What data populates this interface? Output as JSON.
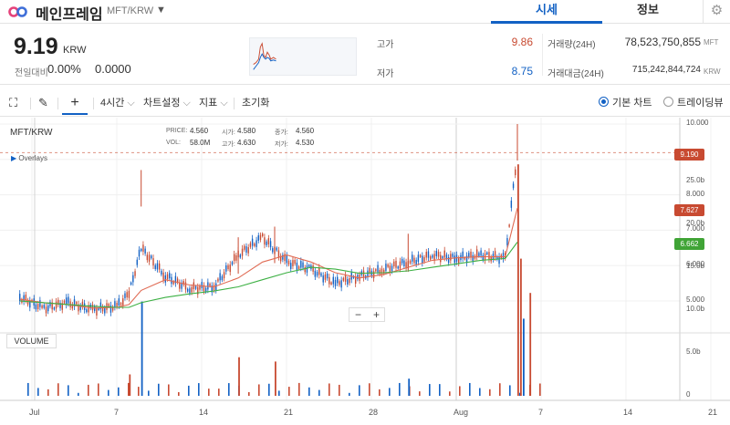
{
  "header": {
    "coin_name": "메인프레임",
    "pair": "MFT/KRW",
    "tabs": [
      {
        "label": "시세",
        "active": true
      },
      {
        "label": "정보",
        "active": false
      }
    ]
  },
  "summary": {
    "price": "9.19",
    "unit": "KRW",
    "change_label": "전일대비",
    "change_rate": "0.00%",
    "change_amount": "0.0000",
    "high_label": "고가",
    "high": "9.86",
    "low_label": "저가",
    "low": "8.75",
    "volume_label": "거래량(24H)",
    "volume": "78,523,750,855",
    "volume_unit": "MFT",
    "value_label": "거래대금(24H)",
    "value": "715,242,844,724",
    "value_unit": "KRW"
  },
  "toolbar": {
    "interval": "4시간",
    "chart_settings": "차트설정",
    "indicators": "지표",
    "reset": "초기화",
    "view_basic": "기본 차트",
    "view_trading": "트레이딩뷰"
  },
  "chart_labels": {
    "pair": "MFT/KRW",
    "overlays": "Overlays",
    "legend": {
      "price_key": "PRICE:",
      "price": "4.560",
      "open_key": "시가:",
      "open": "4.580",
      "close_key": "종가:",
      "close": "4.560",
      "vol_key": "VOL:",
      "vol": "58.0M",
      "high_key": "고가:",
      "high": "4.630",
      "low_key": "저가:",
      "low": "4.530"
    },
    "volume": "VOLUME",
    "zoom_out": "−",
    "zoom_in": "+",
    "tag_current": "9.190",
    "tag_ma_fast": "7.627",
    "tag_ma_slow": "6.662"
  },
  "colors": {
    "up": "#c84a31",
    "down": "#1261c4",
    "accent": "#1261c4",
    "ma_fast": "#e06b54",
    "ma_slow": "#3cb043",
    "ma_slow_tag": "#40a436"
  },
  "chart_data": [
    {
      "type": "line",
      "title": "",
      "x_ticks": [
        "Jul",
        "7",
        "14",
        "21",
        "28",
        "Aug",
        "7",
        "14",
        "21"
      ],
      "y_ticks": [
        "5.000",
        "6.000",
        "7.000",
        "8.000",
        "9.000",
        "10.000"
      ],
      "ylim": [
        4.0,
        10.1
      ],
      "current_price": 9.19,
      "series": [
        {
          "x": [
            "Jun 30",
            "Jul 2",
            "Jul 4",
            "Jul 6",
            "Jul 8",
            "Jul 9",
            "Jul 10",
            "Jul 12",
            "Jul 14",
            "Jul 16",
            "Jul 18",
            "Jul 20",
            "Jul 22",
            "Jul 24",
            "Jul 26",
            "Jul 28",
            "Jul 30",
            "Aug 1",
            "Aug 3",
            "Aug 5",
            "Aug 7",
            "Aug 9",
            "Aug 10"
          ],
          "values": [
            5.1,
            4.8,
            4.95,
            4.75,
            4.85,
            5.2,
            6.5,
            5.7,
            5.35,
            5.4,
            6.3,
            6.8,
            6.1,
            5.9,
            5.5,
            5.7,
            5.9,
            6.1,
            6.3,
            6.2,
            6.3,
            6.2,
            9.19
          ]
        },
        {
          "values": [
            5.05,
            4.95,
            4.9,
            4.8,
            4.82,
            4.9,
            5.3,
            5.6,
            5.45,
            5.4,
            5.65,
            6.1,
            6.3,
            6.1,
            5.8,
            5.65,
            5.75,
            5.95,
            6.15,
            6.22,
            6.25,
            6.25,
            7.627
          ]
        },
        {
          "values": [
            5.0,
            4.95,
            4.9,
            4.85,
            4.82,
            4.82,
            4.95,
            5.1,
            5.2,
            5.28,
            5.4,
            5.6,
            5.8,
            5.95,
            5.9,
            5.78,
            5.8,
            5.85,
            5.95,
            6.05,
            6.15,
            6.2,
            6.662
          ]
        }
      ]
    },
    {
      "type": "bar",
      "title": "",
      "y_ticks": [
        "0",
        "5.0b",
        "10.0b",
        "15.0b",
        "20.0b",
        "25.0b"
      ],
      "ylim": [
        0,
        27
      ],
      "x": [
        "Jul 9",
        "Jul 10",
        "Jul 18",
        "Jul 21",
        "Aug 1",
        "Aug 10a",
        "Aug 10b",
        "Aug 10c",
        "Aug 11"
      ],
      "values": [
        2.5,
        11.0,
        4.5,
        4.0,
        2.0,
        27.0,
        16.0,
        9.0,
        12.0
      ]
    }
  ]
}
